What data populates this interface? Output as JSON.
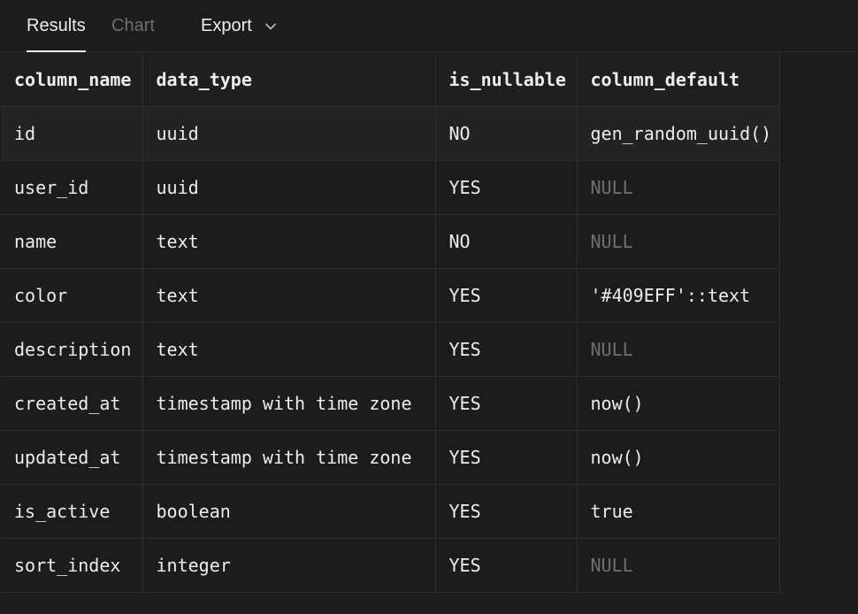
{
  "tabs": {
    "results": "Results",
    "chart": "Chart",
    "export": "Export"
  },
  "table": {
    "headers": [
      "column_name",
      "data_type",
      "is_nullable",
      "column_default"
    ],
    "rows": [
      [
        "id",
        "uuid",
        "NO",
        "gen_random_uuid()"
      ],
      [
        "user_id",
        "uuid",
        "YES",
        "NULL"
      ],
      [
        "name",
        "text",
        "NO",
        "NULL"
      ],
      [
        "color",
        "text",
        "YES",
        "'#409EFF'::text"
      ],
      [
        "description",
        "text",
        "YES",
        "NULL"
      ],
      [
        "created_at",
        "timestamp with time zone",
        "YES",
        "now()"
      ],
      [
        "updated_at",
        "timestamp with time zone",
        "YES",
        "now()"
      ],
      [
        "is_active",
        "boolean",
        "YES",
        "true"
      ],
      [
        "sort_index",
        "integer",
        "YES",
        "NULL"
      ]
    ]
  },
  "colors": {
    "background": "#1c1c1c",
    "text": "#ededed",
    "muted": "#6f6f6f",
    "border": "#2e2e2e"
  }
}
